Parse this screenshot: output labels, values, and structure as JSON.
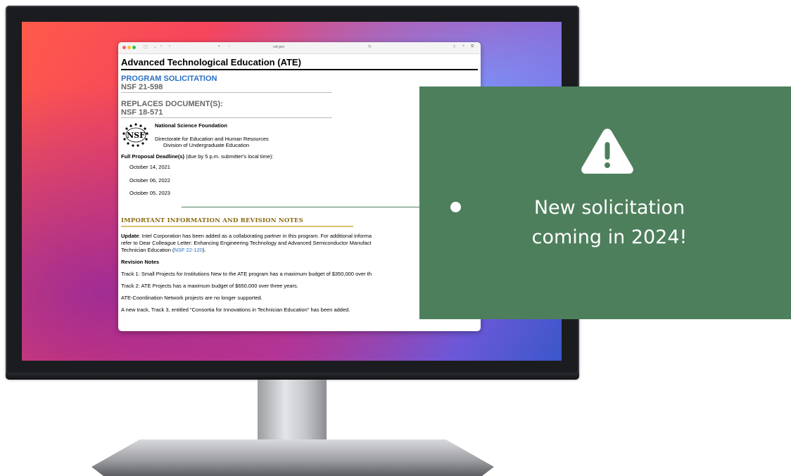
{
  "browser": {
    "url": "nsf.gov"
  },
  "page": {
    "title": "Advanced Technological Education (ATE)",
    "solicitation_label": "PROGRAM SOLICITATION",
    "solicitation_number": "NSF 21-598",
    "replaces_label": "REPLACES DOCUMENT(S):",
    "replaces_number": "NSF 18-571",
    "logo_text": "NSF",
    "agency": "National Science Foundation",
    "directorate": "Directorate for Education and Human Resources",
    "division": "Division of Undergraduate Education",
    "deadline_label": "Full Proposal Deadline(s)",
    "deadline_note": " (due by 5 p.m. submitter's local time):",
    "deadlines": [
      "October 14, 2021",
      "October 06, 2022",
      "October 05, 2023"
    ],
    "important_heading": "IMPORTANT INFORMATION AND REVISION NOTES",
    "update_label": "Update",
    "update_text_1": ": Intel Corporation has been added as a collaborating partner in this program. For additional informa",
    "update_text_2": "refer to Dear Colleague Letter: Enhancing Engineering Technology and Advanced Semiconductor Manufact",
    "update_text_3": "Technician Education (",
    "update_link": "NSF 22-120",
    "update_text_4": ").",
    "revision_heading": "Revision Notes",
    "revision_items": [
      "Track 1: Small Projects for Institutions New to the ATE program has a maximum budget of $350,000 over th",
      "Track 2: ATE Projects has a maximum budget of $650,000 over three years.",
      "ATE-Coordination Network projects are no longer supported.",
      "A new track, Track 3, entitled \"Consortia for Innovations in Technician Education\" has been added."
    ]
  },
  "callout": {
    "icon": "warning-icon",
    "line1": "New solicitation",
    "line2": "coming in 2024!",
    "color": "#4e7f5c"
  }
}
